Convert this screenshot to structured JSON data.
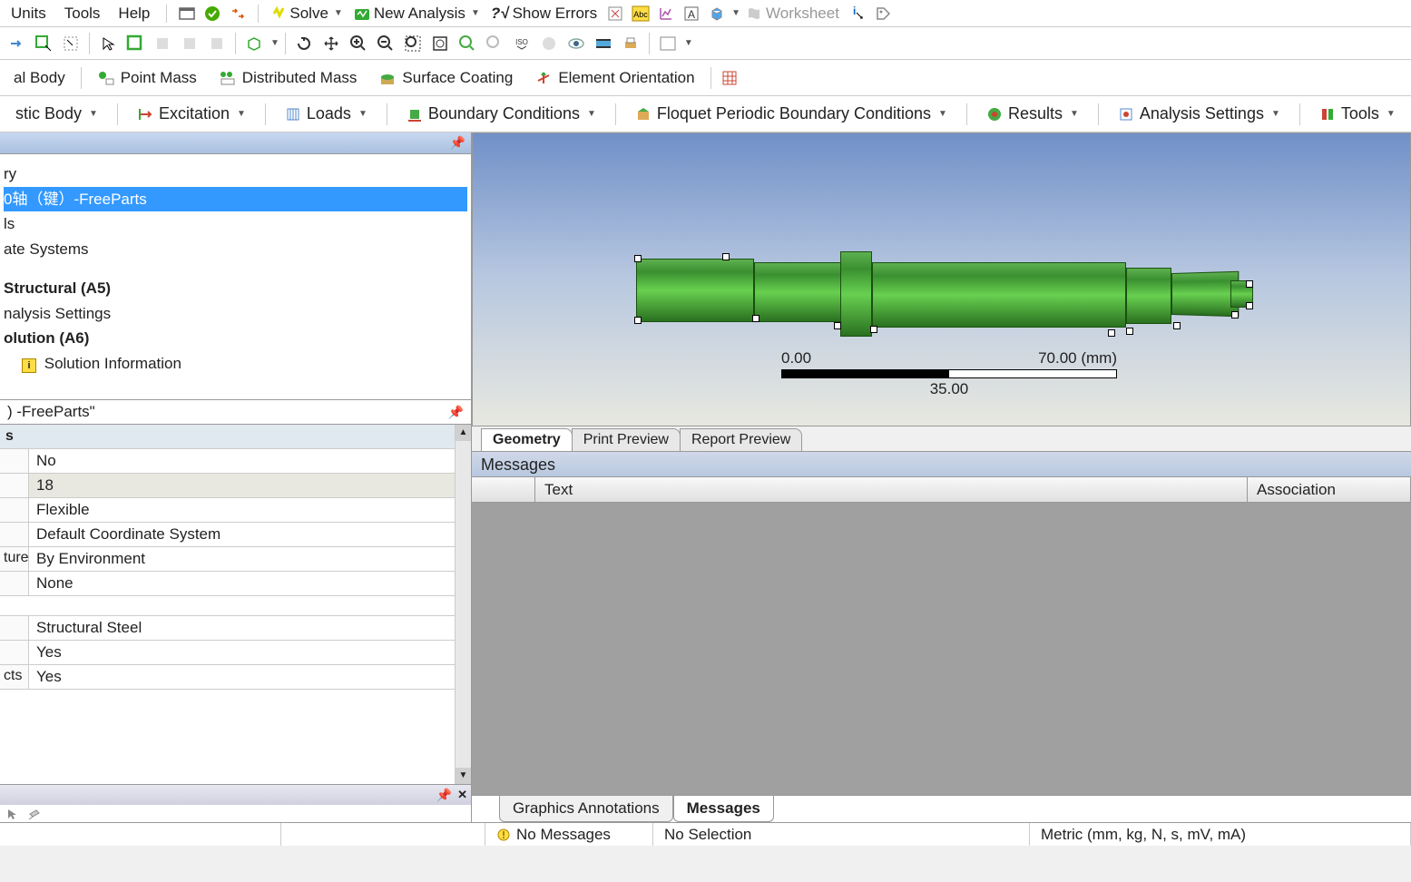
{
  "menus": {
    "units": "Units",
    "tools": "Tools",
    "help": "Help"
  },
  "toolbar1": {
    "solve": "Solve",
    "new_analysis": "New Analysis",
    "show_errors": "Show Errors",
    "worksheet": "Worksheet"
  },
  "toolbar3": {
    "body": "al Body",
    "point_mass": "Point Mass",
    "dist_mass": "Distributed Mass",
    "surface_coating": "Surface Coating",
    "elem_orient": "Element Orientation"
  },
  "ribbon": {
    "body": "stic Body",
    "excitation": "Excitation",
    "loads": "Loads",
    "bc": "Boundary Conditions",
    "floquet": "Floquet Periodic Boundary Conditions",
    "results": "Results",
    "settings": "Analysis Settings",
    "tools": "Tools"
  },
  "tree": {
    "items": [
      {
        "label": "ry",
        "bold": false,
        "selected": false
      },
      {
        "label": "0轴（键）-FreeParts",
        "bold": false,
        "selected": true
      },
      {
        "label": "ls",
        "bold": false,
        "selected": false
      },
      {
        "label": "ate Systems",
        "bold": false,
        "selected": false
      },
      {
        "label": "",
        "bold": false,
        "selected": false
      },
      {
        "label": "Structural (A5)",
        "bold": true,
        "selected": false
      },
      {
        "label": "nalysis Settings",
        "bold": false,
        "selected": false
      },
      {
        "label": "olution (A6)",
        "bold": true,
        "selected": false
      },
      {
        "label": "Solution Information",
        "bold": false,
        "selected": false,
        "icon": true
      }
    ]
  },
  "details": {
    "title": ") -FreeParts\"",
    "group": "s",
    "rows": [
      {
        "label": "",
        "value": "No",
        "shaded": false
      },
      {
        "label": "",
        "value": "18",
        "shaded": true
      },
      {
        "label": "",
        "value": "Flexible",
        "shaded": false
      },
      {
        "label": "",
        "value": "Default Coordinate System",
        "shaded": false
      },
      {
        "label": "ture",
        "value": "By Environment",
        "shaded": false
      },
      {
        "label": "",
        "value": "None",
        "shaded": false
      }
    ],
    "rows2": [
      {
        "label": "",
        "value": "Structural Steel",
        "shaded": false
      },
      {
        "label": "",
        "value": "Yes",
        "shaded": false
      },
      {
        "label": "cts",
        "value": "Yes",
        "shaded": false
      }
    ]
  },
  "viewport": {
    "scale": {
      "min": "0.00",
      "max": "70.00 (mm)",
      "mid": "35.00"
    },
    "tabs": {
      "geometry": "Geometry",
      "print": "Print Preview",
      "report": "Report Preview"
    }
  },
  "messages": {
    "title": "Messages",
    "cols": {
      "blank": "",
      "text": "Text",
      "assoc": "Association"
    }
  },
  "bottom_tabs": {
    "annot": "Graphics Annotations",
    "msg": "Messages"
  },
  "status": {
    "no_msg": "No Messages",
    "no_sel": "No Selection",
    "units": "Metric (mm, kg, N, s, mV, mA)"
  }
}
